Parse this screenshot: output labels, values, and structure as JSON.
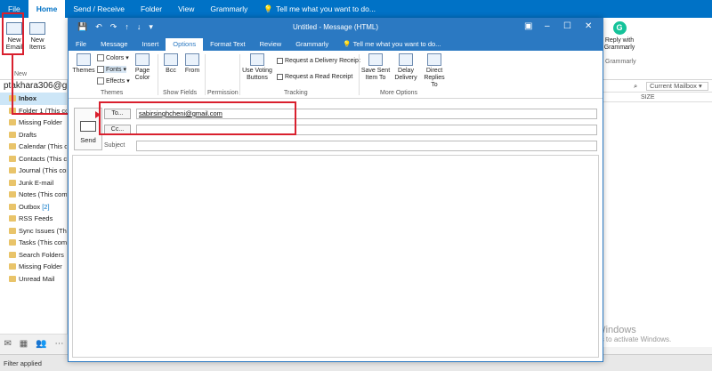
{
  "main_tabs": [
    "File",
    "Home",
    "Send / Receive",
    "Folder",
    "View",
    "Grammarly",
    "Tell me what you want to do..."
  ],
  "main_ribbon": {
    "new_email": "New Email",
    "new_items": "New Items",
    "new_group": "New",
    "grammarly_reply": "Reply with Grammarly",
    "grammarly_group": "Grammarly"
  },
  "account": "ptakhara306@gm",
  "folders": [
    {
      "label": "Inbox",
      "selected": true
    },
    {
      "label": "Folder 1 (This co"
    },
    {
      "label": "Missing Folder"
    },
    {
      "label": "Drafts"
    },
    {
      "label": "Calendar (This co"
    },
    {
      "label": "Contacts (This co"
    },
    {
      "label": "Journal (This com"
    },
    {
      "label": "Junk E-mail"
    },
    {
      "label": "Notes (This comp"
    },
    {
      "label": "Outbox",
      "count": "[2]"
    },
    {
      "label": "RSS Feeds"
    },
    {
      "label": "Sync Issues (This"
    },
    {
      "label": "Tasks (This comp"
    },
    {
      "label": "Search Folders"
    },
    {
      "label": "Missing Folder"
    },
    {
      "label": "Unread Mail"
    }
  ],
  "list_pane": {
    "mailbox_scope": "Current Mailbox",
    "col_size": "SIZE"
  },
  "status_bar": {
    "text": "Filter applied"
  },
  "watermark": {
    "line1": "Activate Windows",
    "line2": "Go to Settings to activate Windows."
  },
  "compose": {
    "title": "Untitled - Message (HTML)",
    "tabs": [
      "File",
      "Message",
      "Insert",
      "Options",
      "Format Text",
      "Review",
      "Grammarly",
      "Tell me what you want to do..."
    ],
    "active_tab": "Options",
    "ribbon": {
      "themes": "Themes",
      "colors": "Colors",
      "fonts": "Fonts",
      "effects": "Effects",
      "page_color": "Page Color",
      "bcc": "Bcc",
      "from": "From",
      "use_voting": "Use Voting Buttons",
      "delivery_receipt": "Request a Delivery Receipt",
      "read_receipt": "Request a Read Receipt",
      "save_sent": "Save Sent Item To",
      "delay": "Delay Delivery",
      "direct_replies": "Direct Replies To",
      "groups": [
        "Themes",
        "Show Fields",
        "Permission",
        "Tracking",
        "More Options"
      ]
    },
    "send": "Send",
    "to_label": "To...",
    "cc_label": "Cc...",
    "subject_label": "Subject",
    "to_value": "sabirsinghcheni@gmail.com",
    "cc_value": "",
    "subject_value": ""
  }
}
